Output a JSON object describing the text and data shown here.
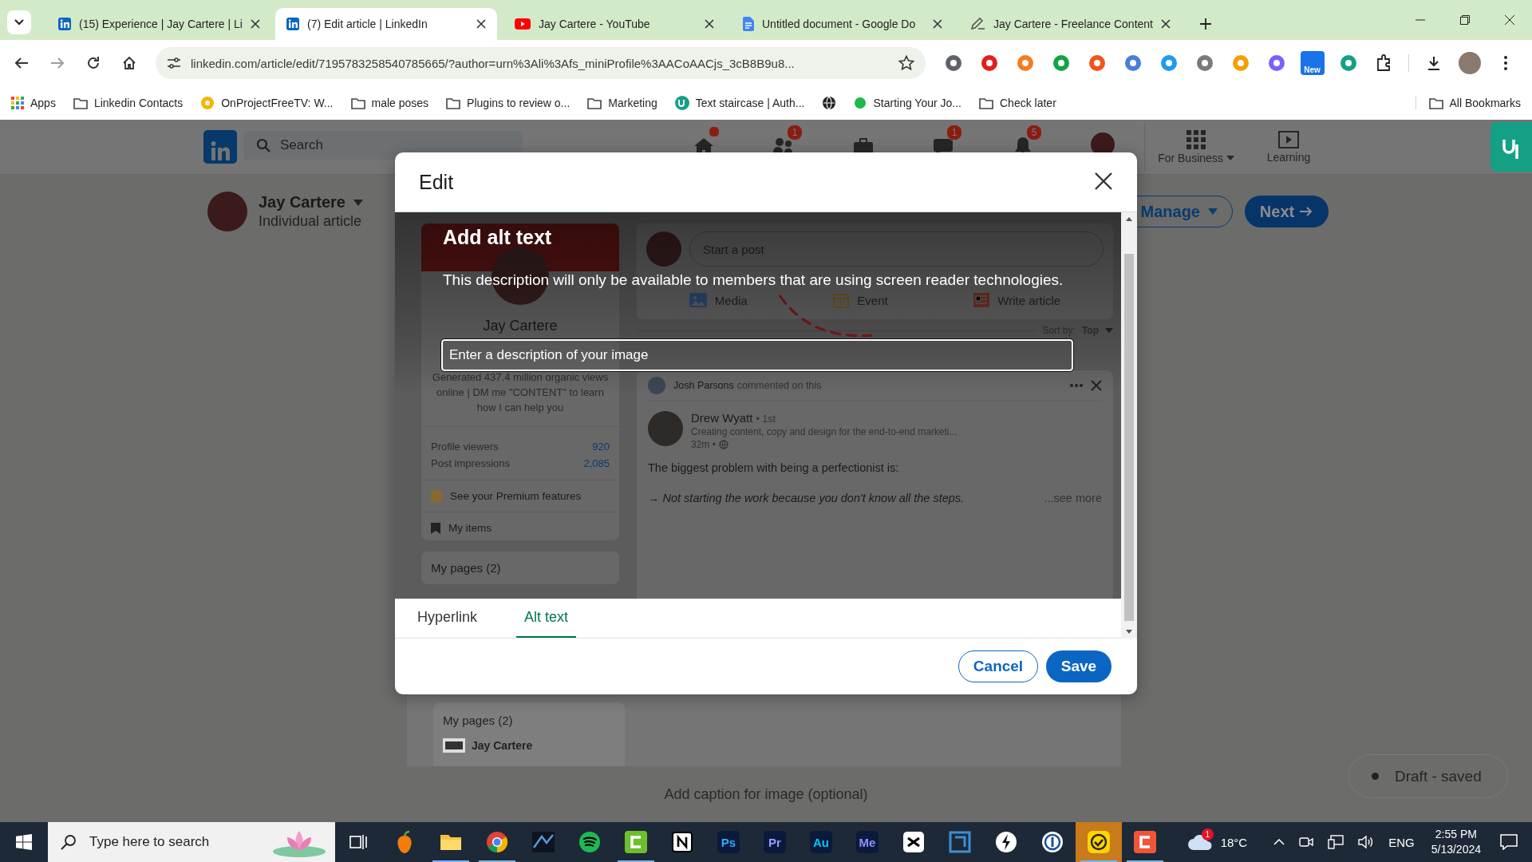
{
  "browser": {
    "tabs": [
      {
        "kind": "linkedin",
        "title": "(15) Experience | Jay Cartere | Li",
        "selected": false
      },
      {
        "kind": "linkedin",
        "title": "(7) Edit article | LinkedIn",
        "selected": true
      },
      {
        "kind": "youtube",
        "title": "Jay Cartere - YouTube",
        "selected": false
      },
      {
        "kind": "docs",
        "title": "Untitled document - Google Do",
        "selected": false
      },
      {
        "kind": "pen",
        "title": "Jay Cartere - Freelance Content",
        "selected": false
      }
    ],
    "address": "linkedin.com/article/edit/7195783258540785665/?author=urn%3Ali%3Afs_miniProfile%3AACoAACjs_3cB8B9u8...",
    "extension_badge": "New",
    "bookmarks": [
      {
        "kind": "apps",
        "label": "Apps"
      },
      {
        "kind": "folder",
        "label": "Linkedin Contacts"
      },
      {
        "kind": "site",
        "label": "OnProjectFreeTV: W..."
      },
      {
        "kind": "folder",
        "label": "male poses"
      },
      {
        "kind": "folder",
        "label": "Plugins to review o..."
      },
      {
        "kind": "folder",
        "label": "Marketing"
      },
      {
        "kind": "upwork",
        "label": "Text staircase | Auth..."
      },
      {
        "kind": "globe"
      },
      {
        "kind": "dot",
        "label": "Starting Your Jo..."
      },
      {
        "kind": "folder",
        "label": "Check later"
      }
    ],
    "all_bookmarks": "All Bookmarks"
  },
  "linkedin": {
    "search_placeholder": "Search",
    "nav": [
      {
        "kind": "home",
        "dot": true
      },
      {
        "kind": "network",
        "dot": false,
        "badge": "1"
      },
      {
        "kind": "jobs",
        "dot": false
      },
      {
        "kind": "messaging",
        "dot": false,
        "badge": "1"
      },
      {
        "kind": "notifications",
        "dot": false,
        "badge": "5"
      },
      {
        "kind": "me",
        "dot": false
      }
    ],
    "for_business": "For Business",
    "learning": "Learning",
    "author": {
      "name": "Jay Cartere",
      "subtitle": "Individual article"
    },
    "manage": "Manage",
    "next": "Next",
    "pages_card": {
      "title": "My pages (2)",
      "page": "Jay Cartere"
    },
    "caption": {
      "placeholder": "Add caption for image (optional)"
    },
    "draft_status": "Draft - saved"
  },
  "modal": {
    "title": "Edit",
    "image": {
      "profile": {
        "name": "Jay Cartere",
        "bio": "Generated 437.4 million organic views online | DM me \"CONTENT\" to learn how I can help you",
        "stats": [
          {
            "label": "Profile viewers",
            "value": "920"
          },
          {
            "label": "Post impressions",
            "value": "2,085"
          }
        ],
        "premium": "See your Premium features",
        "my_items": "My items",
        "pages": "My pages (2)"
      },
      "composer": {
        "placeholder": "Start a post",
        "actions": [
          {
            "kind": "media",
            "label": "Media"
          },
          {
            "kind": "event",
            "label": "Event"
          },
          {
            "kind": "article",
            "label": "Write article"
          }
        ]
      },
      "sort": {
        "label": "Sort by:",
        "value": "Top"
      },
      "post": {
        "activity_name": "Josh Parsons",
        "activity": "commented on this",
        "author": "Drew Wyatt",
        "degree": "• 1st",
        "headline": "Creating content, copy and design for the end-to-end marketi...",
        "time": "32m •",
        "text": "The biggest problem with being a perfectionist is:",
        "quote": "→ Not starting the work because you don't know all the steps.",
        "see_more": "...see more"
      }
    },
    "alt_text": {
      "heading": "Add alt text",
      "description": "This description will only be available to members that are using screen reader technologies.",
      "placeholder": "Enter a description of your image"
    },
    "tabs": [
      {
        "label": "Hyperlink",
        "selected": false
      },
      {
        "label": "Alt text",
        "selected": true
      }
    ],
    "cancel": "Cancel",
    "save": "Save"
  },
  "taskbar": {
    "search_placeholder": "Type here to search",
    "apps": [
      {
        "kind": "taskview",
        "running": false,
        "highlighted": false
      },
      {
        "kind": "fruit",
        "running": false,
        "highlighted": false
      },
      {
        "kind": "folder",
        "running": true,
        "highlighted": false
      },
      {
        "kind": "chrome",
        "running": true,
        "highlighted": false
      },
      {
        "kind": "wave",
        "running": false,
        "highlighted": false
      },
      {
        "kind": "spotify",
        "running": false,
        "highlighted": false
      },
      {
        "kind": "greenc",
        "running": true,
        "highlighted": false
      },
      {
        "kind": "notion",
        "running": false,
        "highlighted": false
      },
      {
        "kind": "letters",
        "label": "Ps",
        "color": "#31a8ff",
        "running": false,
        "highlighted": false
      },
      {
        "kind": "letters",
        "label": "Pr",
        "color": "#9999ff",
        "running": false,
        "highlighted": false
      },
      {
        "kind": "letters",
        "label": "Au",
        "color": "#00c8ff",
        "running": false,
        "highlighted": false
      },
      {
        "kind": "letters",
        "label": "Me",
        "color": "#8f8fff",
        "running": false,
        "highlighted": false
      },
      {
        "kind": "cut",
        "running": false,
        "highlighted": false
      },
      {
        "kind": "frame",
        "running": false,
        "highlighted": false
      },
      {
        "kind": "bolt",
        "running": false,
        "highlighted": false
      },
      {
        "kind": "ring",
        "running": false,
        "highlighted": false
      },
      {
        "kind": "check",
        "running": true,
        "highlighted": true
      },
      {
        "kind": "redc",
        "running": true,
        "highlighted": false
      }
    ],
    "weather_badge": "1",
    "temperature": "18°C",
    "language": "ENG",
    "time": "2:55 PM",
    "date": "5/13/2024"
  }
}
